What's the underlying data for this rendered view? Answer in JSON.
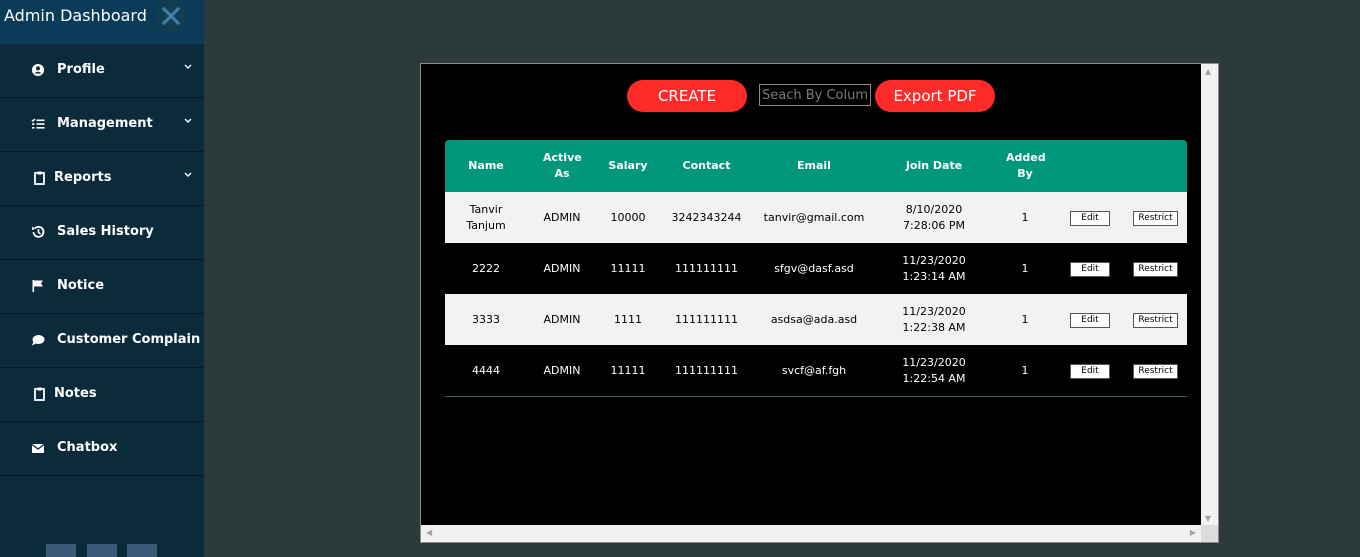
{
  "sidebar": {
    "title": "Admin Dashboard",
    "items": [
      {
        "label": "Profile",
        "icon": "user-circle-icon",
        "has_dropdown": true
      },
      {
        "label": "Management",
        "icon": "list-icon",
        "has_dropdown": true
      },
      {
        "label": "Reports",
        "icon": "clipboard-icon",
        "has_dropdown": true
      },
      {
        "label": "Sales History",
        "icon": "history-icon",
        "has_dropdown": false
      },
      {
        "label": "Notice",
        "icon": "flag-icon",
        "has_dropdown": false
      },
      {
        "label": "Customer Complain",
        "icon": "comment-icon",
        "has_dropdown": false
      },
      {
        "label": "Notes",
        "icon": "clipboard-icon",
        "has_dropdown": false
      },
      {
        "label": "Chatbox",
        "icon": "envelope-icon",
        "has_dropdown": false
      }
    ]
  },
  "toolbar": {
    "create_label": "CREATE",
    "search_placeholder": "Seach By Column",
    "export_label": "Export PDF"
  },
  "table": {
    "headers": [
      "Name",
      "Active As",
      "Salary",
      "Contact",
      "Email",
      "Join Date",
      "Added By",
      "",
      ""
    ],
    "rows": [
      {
        "name": "Tanvir Tanjum",
        "active_as": "ADMIN",
        "salary": "10000",
        "contact": "3242343244",
        "email": "tanvir@gmail.com",
        "join_date": "8/10/2020 7:28:06 PM",
        "added_by": "1",
        "edit": "Edit",
        "restrict": "Restrict"
      },
      {
        "name": "2222",
        "active_as": "ADMIN",
        "salary": "11111",
        "contact": "111111111",
        "email": "sfgv@dasf.asd",
        "join_date": "11/23/2020 1:23:14 AM",
        "added_by": "1",
        "edit": "Edit",
        "restrict": "Restrict"
      },
      {
        "name": "3333",
        "active_as": "ADMIN",
        "salary": "1111",
        "contact": "111111111",
        "email": "asdsa@ada.asd",
        "join_date": "11/23/2020 1:22:38 AM",
        "added_by": "1",
        "edit": "Edit",
        "restrict": "Restrict"
      },
      {
        "name": "4444",
        "active_as": "ADMIN",
        "salary": "11111",
        "contact": "111111111",
        "email": "svcf@af.fgh",
        "join_date": "11/23/2020 1:22:54 AM",
        "added_by": "1",
        "edit": "Edit",
        "restrict": "Restrict"
      }
    ]
  },
  "colors": {
    "sidebar_bg": "#0b2a3a",
    "header_bg": "#00977a",
    "button_red": "#ff2a2a",
    "page_bg": "#2c3a3a"
  }
}
